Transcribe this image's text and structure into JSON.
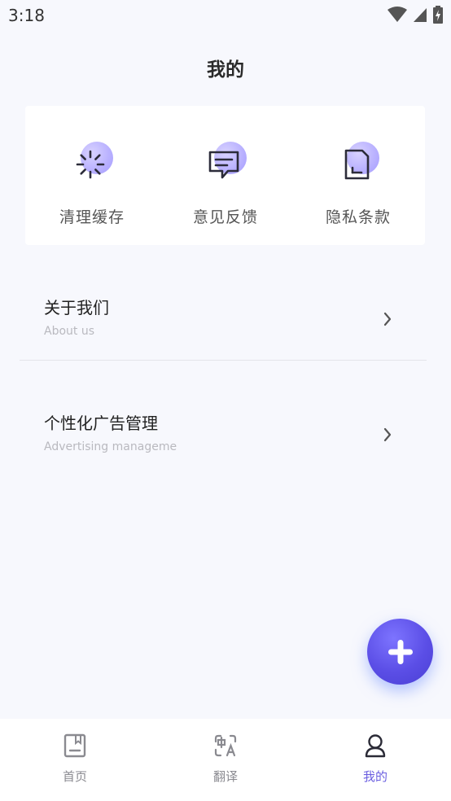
{
  "status_bar": {
    "time": "3:18"
  },
  "header": {
    "title": "我的"
  },
  "quick_actions": [
    {
      "label": "清理缓存",
      "icon": "loading-spinner-icon"
    },
    {
      "label": "意见反馈",
      "icon": "feedback-chat-icon"
    },
    {
      "label": "隐私条款",
      "icon": "document-icon"
    }
  ],
  "menu": [
    {
      "title": "关于我们",
      "subtitle": "About us"
    },
    {
      "title": "个性化广告管理",
      "subtitle": "Advertising manageme"
    }
  ],
  "fab": {
    "icon": "plus-icon"
  },
  "bottom_nav": {
    "items": [
      {
        "label": "首页",
        "icon": "book-icon",
        "active": false
      },
      {
        "label": "翻译",
        "icon": "translate-icon",
        "active": false
      },
      {
        "label": "我的",
        "icon": "user-icon",
        "active": true
      }
    ]
  },
  "colors": {
    "accent": "#6b5fe0",
    "background": "#f7f8fd",
    "fab": "#5b4ee6"
  }
}
